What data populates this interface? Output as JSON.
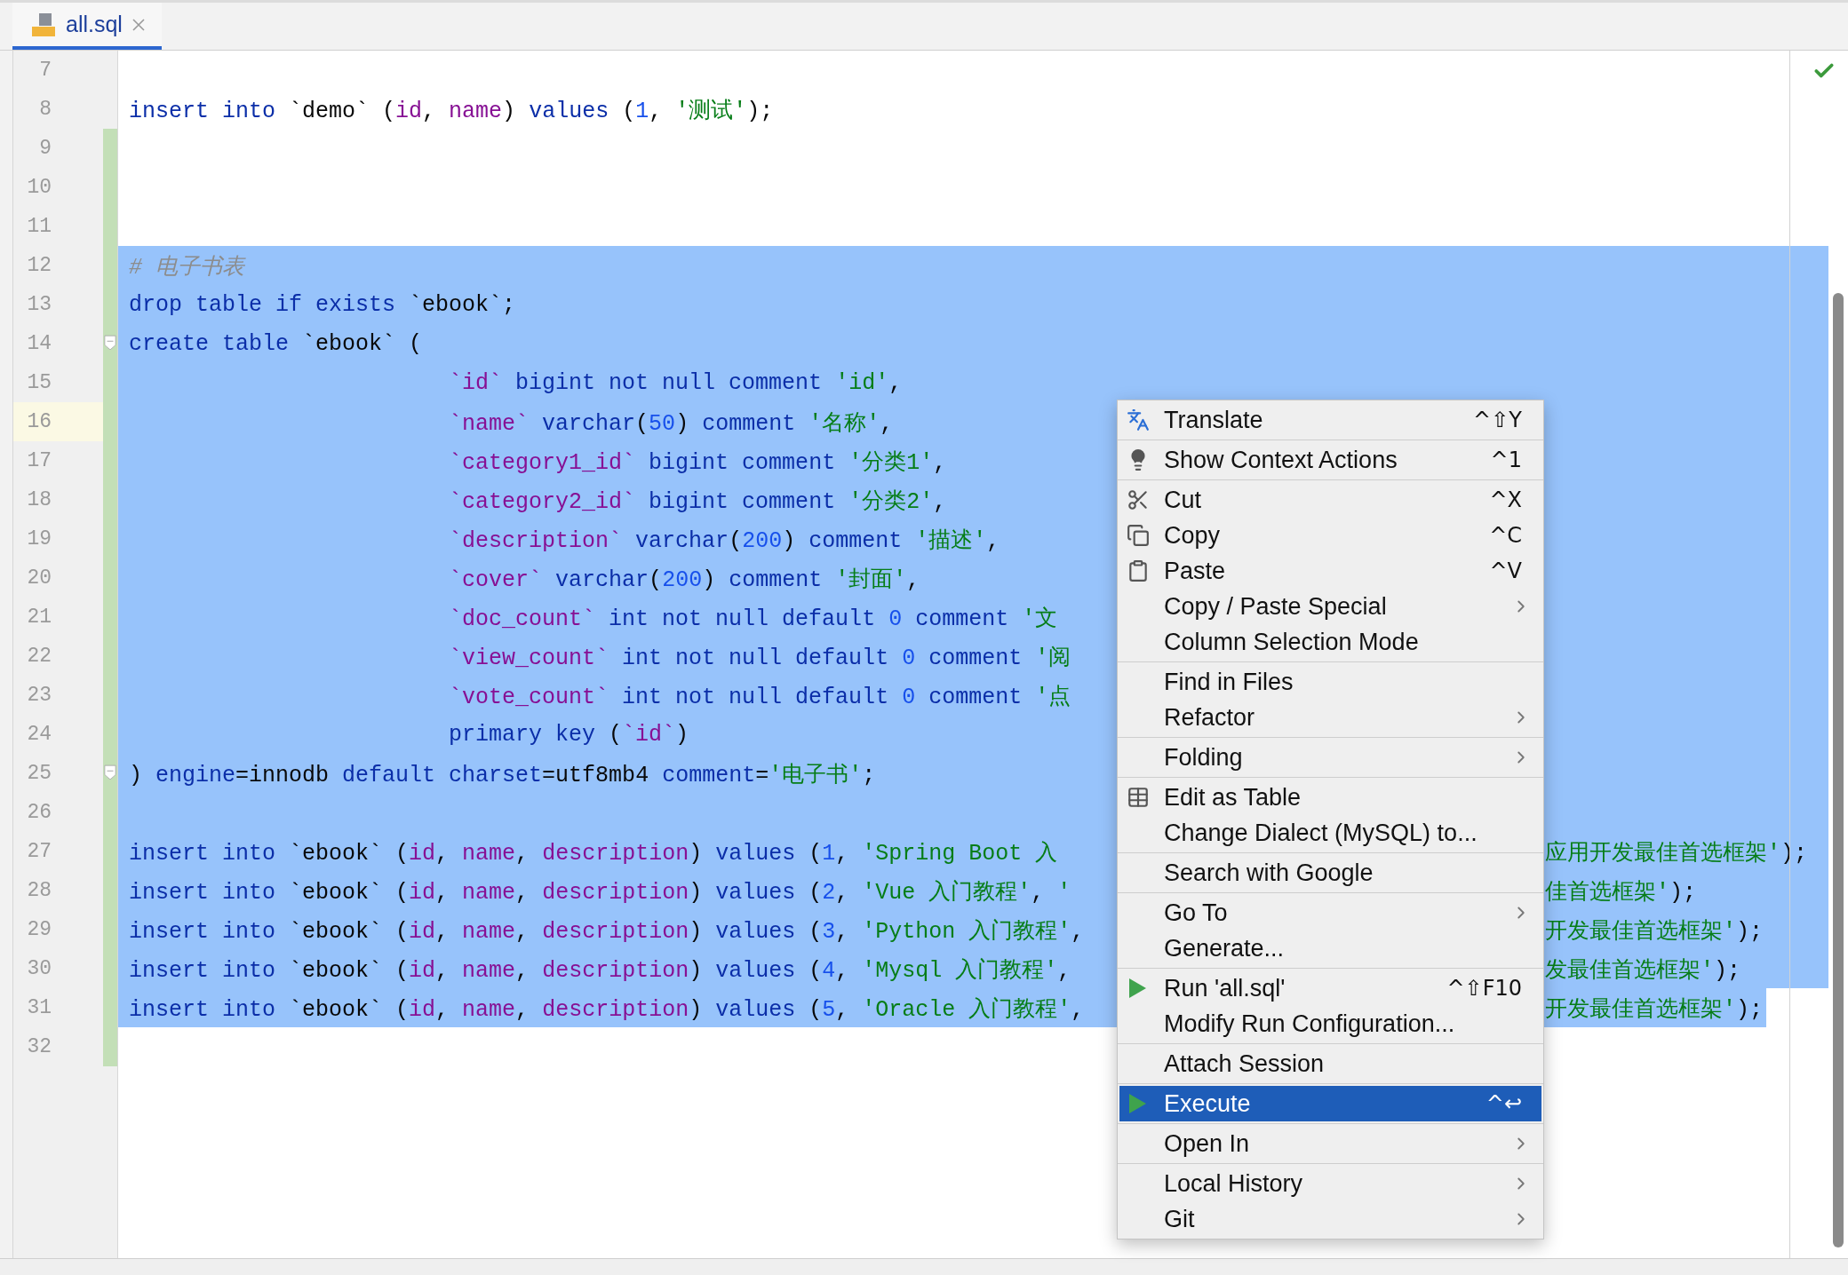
{
  "tab": {
    "label": "all.sql",
    "selected": true
  },
  "lines": [
    {
      "no": "7",
      "selected": false,
      "changed": false,
      "current": false
    },
    {
      "no": "8",
      "tokens": [
        {
          "kind": "kw",
          "text": "insert into "
        },
        {
          "kind": "plain",
          "text": "`demo` ("
        },
        {
          "kind": "col",
          "text": "id"
        },
        {
          "kind": "plain",
          "text": ", "
        },
        {
          "kind": "col",
          "text": "name"
        },
        {
          "kind": "plain",
          "text": ") "
        },
        {
          "kind": "kw",
          "text": "values "
        },
        {
          "kind": "plain",
          "text": "("
        },
        {
          "kind": "num",
          "text": "1"
        },
        {
          "kind": "plain",
          "text": ", "
        },
        {
          "kind": "str",
          "text": "'测试'"
        },
        {
          "kind": "plain",
          "text": ");"
        }
      ],
      "selected": false,
      "changed": false,
      "current": false
    },
    {
      "no": "9",
      "selected": false,
      "changed": true,
      "current": false
    },
    {
      "no": "10",
      "selected": false,
      "changed": true,
      "current": false
    },
    {
      "no": "11",
      "selected": false,
      "changed": true,
      "current": false
    },
    {
      "no": "12",
      "tokens": [
        {
          "kind": "comment",
          "text": "# 电子书表"
        }
      ],
      "selected": true,
      "changed": true,
      "current": false
    },
    {
      "no": "13",
      "tokens": [
        {
          "kind": "kw",
          "text": "drop table if exists "
        },
        {
          "kind": "plain",
          "text": "`ebook`;"
        }
      ],
      "selected": true,
      "changed": true,
      "current": false
    },
    {
      "no": "14",
      "tokens": [
        {
          "kind": "kw",
          "text": "create table "
        },
        {
          "kind": "plain",
          "text": "`ebook` ("
        }
      ],
      "selected": true,
      "changed": true,
      "current": false,
      "fold": true
    },
    {
      "no": "15",
      "tokens": [
        {
          "kind": "col",
          "text": "`id`"
        },
        {
          "kind": "kw",
          "text": " bigint not null comment "
        },
        {
          "kind": "str",
          "text": "'id'"
        },
        {
          "kind": "plain",
          "text": ","
        }
      ],
      "selected": true,
      "changed": true,
      "current": false,
      "indented": true
    },
    {
      "no": "16",
      "tokens": [
        {
          "kind": "col",
          "text": "`name`"
        },
        {
          "kind": "kw",
          "text": " varchar"
        },
        {
          "kind": "plain",
          "text": "("
        },
        {
          "kind": "num",
          "text": "50"
        },
        {
          "kind": "plain",
          "text": ") "
        },
        {
          "kind": "kw",
          "text": "comment "
        },
        {
          "kind": "str",
          "text": "'名称'"
        },
        {
          "kind": "plain",
          "text": ","
        }
      ],
      "selected": true,
      "changed": true,
      "current": true,
      "indented": true
    },
    {
      "no": "17",
      "tokens": [
        {
          "kind": "col",
          "text": "`category1_id`"
        },
        {
          "kind": "kw",
          "text": " bigint comment "
        },
        {
          "kind": "str",
          "text": "'分类1'"
        },
        {
          "kind": "plain",
          "text": ","
        }
      ],
      "selected": true,
      "changed": true,
      "current": false,
      "indented": true
    },
    {
      "no": "18",
      "tokens": [
        {
          "kind": "col",
          "text": "`category2_id`"
        },
        {
          "kind": "kw",
          "text": " bigint comment "
        },
        {
          "kind": "str",
          "text": "'分类2'"
        },
        {
          "kind": "plain",
          "text": ","
        }
      ],
      "selected": true,
      "changed": true,
      "current": false,
      "indented": true
    },
    {
      "no": "19",
      "tokens": [
        {
          "kind": "col",
          "text": "`description`"
        },
        {
          "kind": "kw",
          "text": " varchar"
        },
        {
          "kind": "plain",
          "text": "("
        },
        {
          "kind": "num",
          "text": "200"
        },
        {
          "kind": "plain",
          "text": ") "
        },
        {
          "kind": "kw",
          "text": "comment "
        },
        {
          "kind": "str",
          "text": "'描述'"
        },
        {
          "kind": "plain",
          "text": ","
        }
      ],
      "selected": true,
      "changed": true,
      "current": false,
      "indented": true
    },
    {
      "no": "20",
      "tokens": [
        {
          "kind": "col",
          "text": "`cover`"
        },
        {
          "kind": "kw",
          "text": " varchar"
        },
        {
          "kind": "plain",
          "text": "("
        },
        {
          "kind": "num",
          "text": "200"
        },
        {
          "kind": "plain",
          "text": ") "
        },
        {
          "kind": "kw",
          "text": "comment "
        },
        {
          "kind": "str",
          "text": "'封面'"
        },
        {
          "kind": "plain",
          "text": ","
        }
      ],
      "selected": true,
      "changed": true,
      "current": false,
      "indented": true
    },
    {
      "no": "21",
      "tokens": [
        {
          "kind": "col",
          "text": "`doc_count`"
        },
        {
          "kind": "kw",
          "text": " int not null default "
        },
        {
          "kind": "num",
          "text": "0"
        },
        {
          "kind": "kw",
          "text": " comment "
        },
        {
          "kind": "str",
          "text": "'文"
        }
      ],
      "selected": true,
      "changed": true,
      "current": false,
      "indented": true
    },
    {
      "no": "22",
      "tokens": [
        {
          "kind": "col",
          "text": "`view_count`"
        },
        {
          "kind": "kw",
          "text": " int not null default "
        },
        {
          "kind": "num",
          "text": "0"
        },
        {
          "kind": "kw",
          "text": " comment "
        },
        {
          "kind": "str",
          "text": "'阅"
        }
      ],
      "selected": true,
      "changed": true,
      "current": false,
      "indented": true
    },
    {
      "no": "23",
      "tokens": [
        {
          "kind": "col",
          "text": "`vote_count`"
        },
        {
          "kind": "kw",
          "text": " int not null default "
        },
        {
          "kind": "num",
          "text": "0"
        },
        {
          "kind": "kw",
          "text": " comment "
        },
        {
          "kind": "str",
          "text": "'点"
        }
      ],
      "selected": true,
      "changed": true,
      "current": false,
      "indented": true
    },
    {
      "no": "24",
      "tokens": [
        {
          "kind": "kw",
          "text": "primary key "
        },
        {
          "kind": "plain",
          "text": "("
        },
        {
          "kind": "col",
          "text": "`id`"
        },
        {
          "kind": "plain",
          "text": ")"
        }
      ],
      "selected": true,
      "changed": true,
      "current": false,
      "indented": true
    },
    {
      "no": "25",
      "tokens": [
        {
          "kind": "plain",
          "text": ") "
        },
        {
          "kind": "kw",
          "text": "engine"
        },
        {
          "kind": "plain",
          "text": "=innodb "
        },
        {
          "kind": "kw",
          "text": "default charset"
        },
        {
          "kind": "plain",
          "text": "=utf8mb4 "
        },
        {
          "kind": "kw",
          "text": "comment"
        },
        {
          "kind": "plain",
          "text": "="
        },
        {
          "kind": "str",
          "text": "'电子书'"
        },
        {
          "kind": "plain",
          "text": ";"
        }
      ],
      "selected": true,
      "changed": true,
      "current": false,
      "fold": true
    },
    {
      "no": "26",
      "selected": true,
      "changed": true,
      "current": false
    },
    {
      "no": "27",
      "tokens": [
        {
          "kind": "kw",
          "text": "insert into "
        },
        {
          "kind": "plain",
          "text": "`ebook` ("
        },
        {
          "kind": "col",
          "text": "id"
        },
        {
          "kind": "plain",
          "text": ", "
        },
        {
          "kind": "col",
          "text": "name"
        },
        {
          "kind": "plain",
          "text": ", "
        },
        {
          "kind": "col",
          "text": "description"
        },
        {
          "kind": "plain",
          "text": ") "
        },
        {
          "kind": "kw",
          "text": "values "
        },
        {
          "kind": "plain",
          "text": "("
        },
        {
          "kind": "num",
          "text": "1"
        },
        {
          "kind": "plain",
          "text": ", "
        },
        {
          "kind": "str",
          "text": "'Spring Boot 入"
        }
      ],
      "right": [
        {
          "kind": "str",
          "text": "应用开发最佳首选框架'"
        },
        {
          "kind": "plain",
          "text": ");"
        }
      ],
      "selected": true,
      "changed": true,
      "current": false
    },
    {
      "no": "28",
      "tokens": [
        {
          "kind": "kw",
          "text": "insert into "
        },
        {
          "kind": "plain",
          "text": "`ebook` ("
        },
        {
          "kind": "col",
          "text": "id"
        },
        {
          "kind": "plain",
          "text": ", "
        },
        {
          "kind": "col",
          "text": "name"
        },
        {
          "kind": "plain",
          "text": ", "
        },
        {
          "kind": "col",
          "text": "description"
        },
        {
          "kind": "plain",
          "text": ") "
        },
        {
          "kind": "kw",
          "text": "values "
        },
        {
          "kind": "plain",
          "text": "("
        },
        {
          "kind": "num",
          "text": "2"
        },
        {
          "kind": "plain",
          "text": ", "
        },
        {
          "kind": "str",
          "text": "'Vue 入门教程'"
        },
        {
          "kind": "plain",
          "text": ", "
        },
        {
          "kind": "str",
          "text": "'"
        }
      ],
      "right": [
        {
          "kind": "str",
          "text": "佳首选框架'"
        },
        {
          "kind": "plain",
          "text": ");"
        }
      ],
      "selected": true,
      "changed": true,
      "current": false
    },
    {
      "no": "29",
      "tokens": [
        {
          "kind": "kw",
          "text": "insert into "
        },
        {
          "kind": "plain",
          "text": "`ebook` ("
        },
        {
          "kind": "col",
          "text": "id"
        },
        {
          "kind": "plain",
          "text": ", "
        },
        {
          "kind": "col",
          "text": "name"
        },
        {
          "kind": "plain",
          "text": ", "
        },
        {
          "kind": "col",
          "text": "description"
        },
        {
          "kind": "plain",
          "text": ") "
        },
        {
          "kind": "kw",
          "text": "values "
        },
        {
          "kind": "plain",
          "text": "("
        },
        {
          "kind": "num",
          "text": "3"
        },
        {
          "kind": "plain",
          "text": ", "
        },
        {
          "kind": "str",
          "text": "'Python 入门教程'"
        },
        {
          "kind": "plain",
          "text": ","
        }
      ],
      "right": [
        {
          "kind": "str",
          "text": "开发最佳首选框架'"
        },
        {
          "kind": "plain",
          "text": ");"
        }
      ],
      "selected": true,
      "changed": true,
      "current": false
    },
    {
      "no": "30",
      "tokens": [
        {
          "kind": "kw",
          "text": "insert into "
        },
        {
          "kind": "plain",
          "text": "`ebook` ("
        },
        {
          "kind": "col",
          "text": "id"
        },
        {
          "kind": "plain",
          "text": ", "
        },
        {
          "kind": "col",
          "text": "name"
        },
        {
          "kind": "plain",
          "text": ", "
        },
        {
          "kind": "col",
          "text": "description"
        },
        {
          "kind": "plain",
          "text": ") "
        },
        {
          "kind": "kw",
          "text": "values "
        },
        {
          "kind": "plain",
          "text": "("
        },
        {
          "kind": "num",
          "text": "4"
        },
        {
          "kind": "plain",
          "text": ", "
        },
        {
          "kind": "str",
          "text": "'Mysql 入门教程'"
        },
        {
          "kind": "plain",
          "text": ","
        }
      ],
      "right": [
        {
          "kind": "str",
          "text": "发最佳首选框架'"
        },
        {
          "kind": "plain",
          "text": ");"
        }
      ],
      "selected": true,
      "changed": true,
      "current": false
    },
    {
      "no": "31",
      "tokens": [
        {
          "kind": "kw",
          "text": "insert into "
        },
        {
          "kind": "plain",
          "text": "`ebook` ("
        },
        {
          "kind": "col",
          "text": "id"
        },
        {
          "kind": "plain",
          "text": ", "
        },
        {
          "kind": "col",
          "text": "name"
        },
        {
          "kind": "plain",
          "text": ", "
        },
        {
          "kind": "col",
          "text": "description"
        },
        {
          "kind": "plain",
          "text": ") "
        },
        {
          "kind": "kw",
          "text": "values "
        },
        {
          "kind": "plain",
          "text": "("
        },
        {
          "kind": "num",
          "text": "5"
        },
        {
          "kind": "plain",
          "text": ", "
        },
        {
          "kind": "str",
          "text": "'Oracle 入门教程'"
        },
        {
          "kind": "plain",
          "text": ","
        }
      ],
      "right": [
        {
          "kind": "str",
          "text": "开发最佳首选框架'"
        },
        {
          "kind": "plain",
          "text": ");"
        }
      ],
      "selected": true,
      "changed": true,
      "current": false
    },
    {
      "no": "32",
      "selected": false,
      "changed": true,
      "current": false
    }
  ],
  "menu": {
    "groups": [
      [
        {
          "label": "Translate",
          "shortcut": "^⇧Y",
          "submenu": false,
          "selected": false
        }
      ],
      [
        {
          "label": "Show Context Actions",
          "shortcut": "^1",
          "submenu": false,
          "selected": false
        }
      ],
      [
        {
          "label": "Cut",
          "shortcut": "^X",
          "submenu": false,
          "selected": false
        },
        {
          "label": "Copy",
          "shortcut": "^C",
          "submenu": false,
          "selected": false
        },
        {
          "label": "Paste",
          "shortcut": "^V",
          "submenu": false,
          "selected": false
        },
        {
          "label": "Copy / Paste Special",
          "submenu": true,
          "selected": false
        },
        {
          "label": "Column Selection Mode",
          "submenu": false,
          "selected": false
        }
      ],
      [
        {
          "label": "Find in Files",
          "submenu": false,
          "selected": false
        },
        {
          "label": "Refactor",
          "submenu": true,
          "selected": false
        }
      ],
      [
        {
          "label": "Folding",
          "submenu": true,
          "selected": false
        }
      ],
      [
        {
          "label": "Edit as Table",
          "submenu": false,
          "selected": false
        },
        {
          "label": "Change Dialect (MySQL) to...",
          "submenu": false,
          "selected": false
        }
      ],
      [
        {
          "label": "Search with Google",
          "submenu": false,
          "selected": false
        }
      ],
      [
        {
          "label": "Go To",
          "submenu": true,
          "selected": false
        },
        {
          "label": "Generate...",
          "submenu": false,
          "selected": false
        }
      ],
      [
        {
          "label": "Run 'all.sql'",
          "shortcut": "^⇧F10",
          "submenu": false,
          "selected": false
        },
        {
          "label": "Modify Run Configuration...",
          "submenu": false,
          "selected": false
        }
      ],
      [
        {
          "label": "Attach Session",
          "submenu": false,
          "selected": false
        }
      ],
      [
        {
          "label": "Execute",
          "shortcut": "^↩",
          "submenu": false,
          "selected": true
        }
      ],
      [
        {
          "label": "Open In",
          "submenu": true,
          "selected": false
        }
      ],
      [
        {
          "label": "Local History",
          "submenu": true,
          "selected": false
        },
        {
          "label": "Git",
          "submenu": true,
          "selected": false
        }
      ]
    ]
  }
}
